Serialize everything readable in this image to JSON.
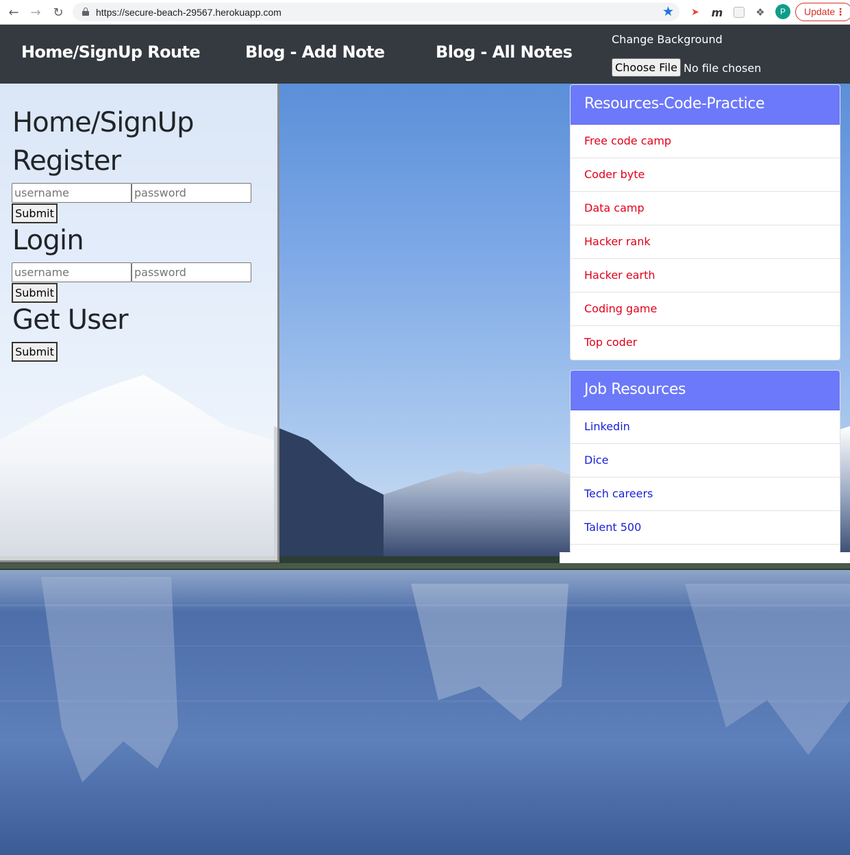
{
  "browser": {
    "url": "https://secure-beach-29567.herokuapp.com",
    "back_icon": "arrow-left-icon",
    "forward_icon": "arrow-right-icon",
    "reload_icon": "reload-icon",
    "bookmark_icon": "star-icon",
    "avatar_initial": "P",
    "update_label": "Update"
  },
  "navbar": {
    "links": [
      "Home/SignUp Route",
      "Blog - Add Note",
      "Blog - All Notes"
    ],
    "change_bg_label": "Change Background",
    "choose_file_label": "Choose File",
    "file_status": "No file chosen"
  },
  "form": {
    "page_title": "Home/SignUp",
    "register": {
      "heading": "Register",
      "username_placeholder": "username",
      "password_placeholder": "password",
      "submit_label": "Submit"
    },
    "login": {
      "heading": "Login",
      "username_placeholder": "username",
      "password_placeholder": "password",
      "submit_label": "Submit"
    },
    "get_user": {
      "heading": "Get User",
      "submit_label": "Submit"
    }
  },
  "resources": {
    "title": "Resources-Code-Practice",
    "items": [
      "Free code camp",
      "Coder byte",
      "Data camp",
      "Hacker rank",
      "Hacker earth",
      "Coding game",
      "Top coder"
    ],
    "link_color": "#e0001b"
  },
  "jobs": {
    "title": "Job Resources",
    "items": [
      "Linkedin",
      "Dice",
      "Tech careers",
      "Talent 500"
    ],
    "link_color": "#1a20d6"
  },
  "colors": {
    "navbar_bg": "#343a40",
    "card_header_bg": "#6c79fa"
  }
}
